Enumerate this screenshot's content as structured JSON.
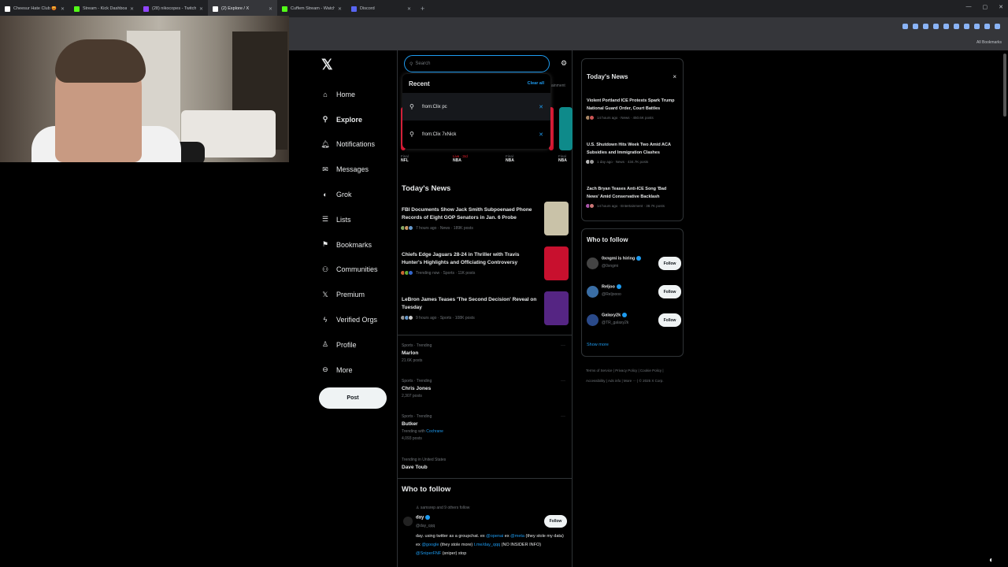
{
  "browser": {
    "tabs": [
      {
        "label": "Cheesur Hate Club 😡 / X",
        "color": "#ffffff"
      },
      {
        "label": "Stream - Kick Dashboard",
        "color": "#53fc18"
      },
      {
        "label": "(28) nikocopes - Twitch",
        "color": "#9146ff"
      },
      {
        "label": "(2) Explore / X",
        "color": "#ffffff"
      },
      {
        "label": "Cuffem Stream - Watch Live o",
        "color": "#53fc18"
      },
      {
        "label": "Discord",
        "color": "#5865f2"
      }
    ],
    "all_bookmarks": "All Bookmarks"
  },
  "nav": {
    "items": [
      {
        "label": "Home",
        "icon": "home-icon",
        "glyph": "⌂"
      },
      {
        "label": "Explore",
        "icon": "search-icon",
        "glyph": "⚲",
        "bold": true
      },
      {
        "label": "Notifications",
        "icon": "bell-icon",
        "glyph": "🔔︎"
      },
      {
        "label": "Messages",
        "icon": "mail-icon",
        "glyph": "✉"
      },
      {
        "label": "Grok",
        "icon": "grok-icon",
        "glyph": "◐"
      },
      {
        "label": "Lists",
        "icon": "list-icon",
        "glyph": "☰"
      },
      {
        "label": "Bookmarks",
        "icon": "bookmark-icon",
        "glyph": "⚑"
      },
      {
        "label": "Communities",
        "icon": "communities-icon",
        "glyph": "⚇"
      },
      {
        "label": "Premium",
        "icon": "x-logo-icon",
        "glyph": "𝕏"
      },
      {
        "label": "Verified Orgs",
        "icon": "lightning-icon",
        "glyph": "ϟ"
      },
      {
        "label": "Profile",
        "icon": "person-icon",
        "glyph": "♙"
      },
      {
        "label": "More",
        "icon": "more-icon",
        "glyph": "⊖"
      }
    ],
    "post_label": "Post"
  },
  "search": {
    "placeholder": "Search",
    "recent_title": "Recent",
    "clear_all": "Clear all",
    "recent": [
      "from:Clix pc",
      "from:Clix 7xNick"
    ]
  },
  "tab_hint": "ainment",
  "scores": [
    {
      "status": "Final",
      "league": "NFL"
    },
    {
      "status": "Live · 3rd",
      "league": "NBA",
      "live": true
    },
    {
      "status": "Final",
      "league": "NBA"
    },
    {
      "status": "Final",
      "league": "NBA"
    }
  ],
  "todays_news": {
    "title": "Today's News",
    "items": [
      {
        "title": "FBI Documents Show Jack Smith Subpoenaed Phone Records of Eight GOP Senators in Jan. 6 Probe",
        "meta": "7 hours ago · News · 189K posts"
      },
      {
        "title": "Chiefs Edge Jaguars 28-24 in Thriller with Travis Hunter's Highlights and Officiating Controversy",
        "meta": "Trending now · Sports · 11K posts"
      },
      {
        "title": "LeBron James Teases 'The Second Decision' Reveal on Tuesday",
        "meta": "9 hours ago · Sports · 108K posts"
      }
    ]
  },
  "trends": [
    {
      "category": "Sports · Trending",
      "name": "Marlon",
      "posts": "21.6K posts"
    },
    {
      "category": "Sports · Trending",
      "name": "Chris Jones",
      "posts": "2,307 posts"
    },
    {
      "category": "Sports · Trending",
      "name": "Butker",
      "with_label": "Trending with",
      "with_link": "Cochrane",
      "posts": "4,093 posts"
    },
    {
      "category": "Trending in United States",
      "name": "Dave Toub",
      "posts": ""
    }
  ],
  "who_to_follow_main": {
    "title": "Who to follow",
    "social": "samsrep and 9 others follow",
    "name": "day",
    "handle": "@day_qqq",
    "follow": "Follow",
    "bio_parts": [
      {
        "t": "day. using twitter as a groupchat. ex "
      },
      {
        "t": "@openai",
        "link": true
      },
      {
        "t": " ex "
      },
      {
        "t": "@meta",
        "link": true
      },
      {
        "t": " (they stole my data) ex "
      },
      {
        "t": "@google",
        "link": true
      },
      {
        "t": " (they stole more) "
      },
      {
        "t": "t.me/day_qqq",
        "link": true
      },
      {
        "t": " (NO INSIDER INFO) "
      },
      {
        "t": "@SniperFNF",
        "link": true
      },
      {
        "t": " (sniper) stop"
      }
    ]
  },
  "right_news": {
    "title": "Today's News",
    "close": "×",
    "items": [
      {
        "title": "Violent Portland ICE Protests Spark Trump National Guard Order, Court Battles",
        "meta": "14 hours ago · News · 450.6K posts"
      },
      {
        "title": "U.S. Shutdown Hits Week Two Amid ACA Subsidies and Immigration Clashes",
        "meta": "1 day ago · News · 434.7K posts"
      },
      {
        "title": "Zach Bryan Teases Anti-ICE Song 'Bad News' Amid Conservative Backlash",
        "meta": "14 hours ago · Entertainment · 38.7K posts"
      }
    ]
  },
  "right_follow": {
    "title": "Who to follow",
    "items": [
      {
        "name": "0xngmi is hiring",
        "handle": "@0xngmi",
        "color": "#444444"
      },
      {
        "name": "Reljoo",
        "handle": "@Reljoooo",
        "color": "#3a6ea5"
      },
      {
        "name": "Galaxy2k",
        "handle": "@TR_galaxy2k",
        "color": "#2a4a8a"
      }
    ],
    "follow": "Follow",
    "show_more": "Show more"
  },
  "footer": {
    "links": [
      "Terms of Service",
      "Privacy Policy",
      "Cookie Policy",
      "Accessibility",
      "Ads info",
      "More ···",
      "© 2025 X Corp."
    ]
  }
}
